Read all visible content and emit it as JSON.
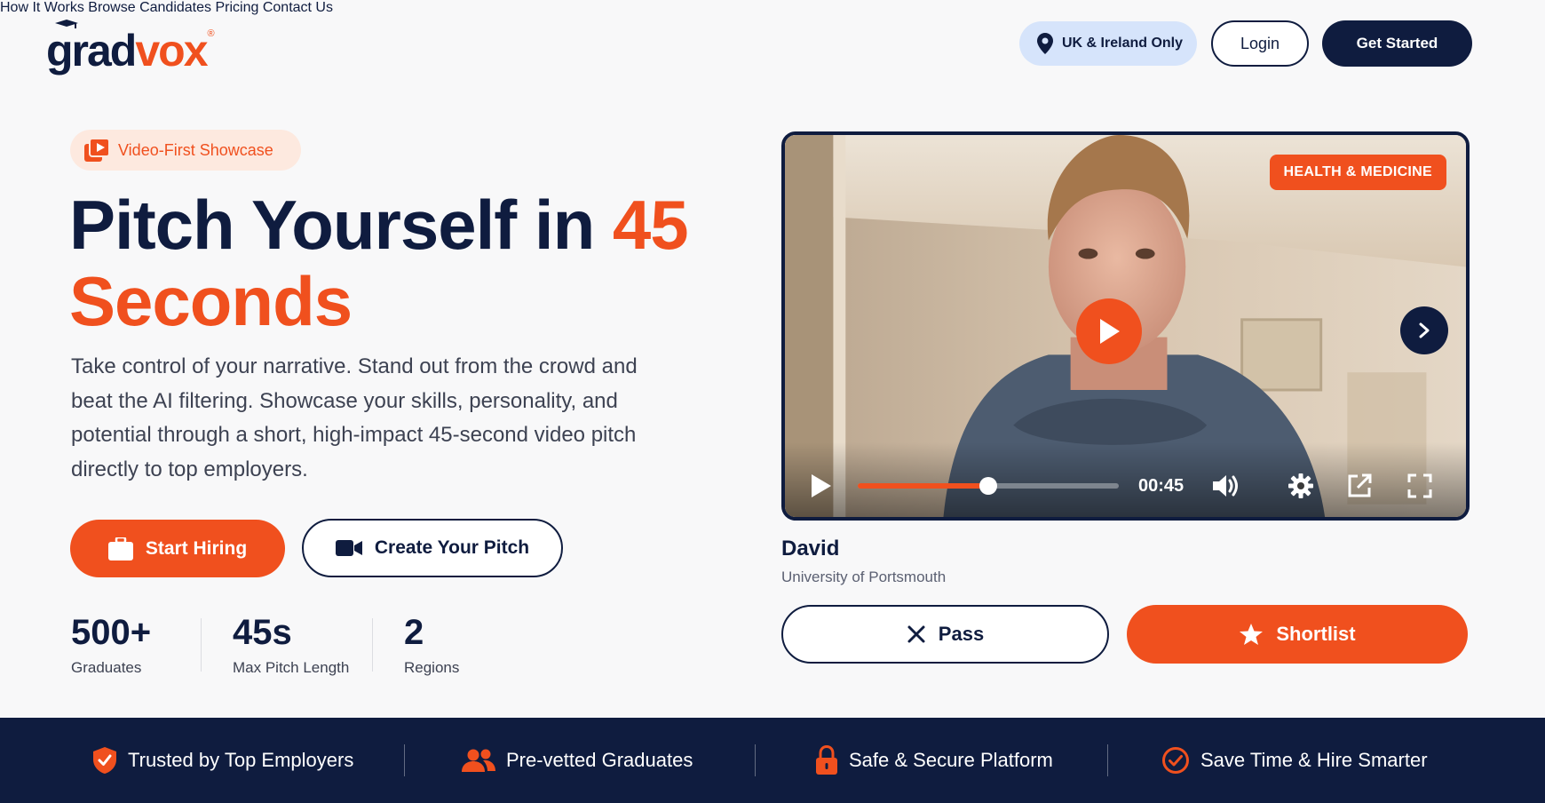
{
  "brand": {
    "name_part1": "grad",
    "name_part2": "vox",
    "registered": "®"
  },
  "nav": {
    "items": [
      {
        "label": "How It Works"
      },
      {
        "label": "Browse Candidates"
      },
      {
        "label": "Pricing"
      },
      {
        "label": "Contact Us"
      }
    ],
    "region_label": "UK & Ireland Only",
    "login_label": "Login",
    "get_started_label": "Get Started"
  },
  "hero": {
    "badge": "Video-First Showcase",
    "title_part1": "Pitch Yourself in ",
    "title_highlight": "45",
    "title_part2": "Seconds",
    "lead": "Take control of your narrative. Stand out from the crowd and beat the AI filtering. Showcase your skills, personality, and potential through a short, high-impact 45-second video pitch directly to top employers.",
    "start_hiring_label": "Start Hiring",
    "create_pitch_label": "Create Your Pitch",
    "stats": [
      {
        "value": "500+",
        "label": "Graduates"
      },
      {
        "value": "45s",
        "label": "Max Pitch Length"
      },
      {
        "value": "2",
        "label": "Regions"
      }
    ]
  },
  "video": {
    "category_tag": "HEALTH & MEDICINE",
    "time": "00:45",
    "progress": 0.5,
    "candidate_name": "David",
    "candidate_university": "University of Portsmouth",
    "pass_label": "Pass",
    "shortlist_label": "Shortlist"
  },
  "trust_bar": {
    "items": [
      {
        "label": "Trusted by Top Employers",
        "icon": "shield-check-icon"
      },
      {
        "label": "Pre-vetted Graduates",
        "icon": "users-icon"
      },
      {
        "label": "Safe & Secure Platform",
        "icon": "lock-icon"
      },
      {
        "label": "Save Time & Hire Smarter",
        "icon": "check-circle-icon"
      }
    ]
  },
  "colors": {
    "navy": "#0f1c3f",
    "orange": "#f0501e",
    "region_bg": "#d6e4fb"
  }
}
